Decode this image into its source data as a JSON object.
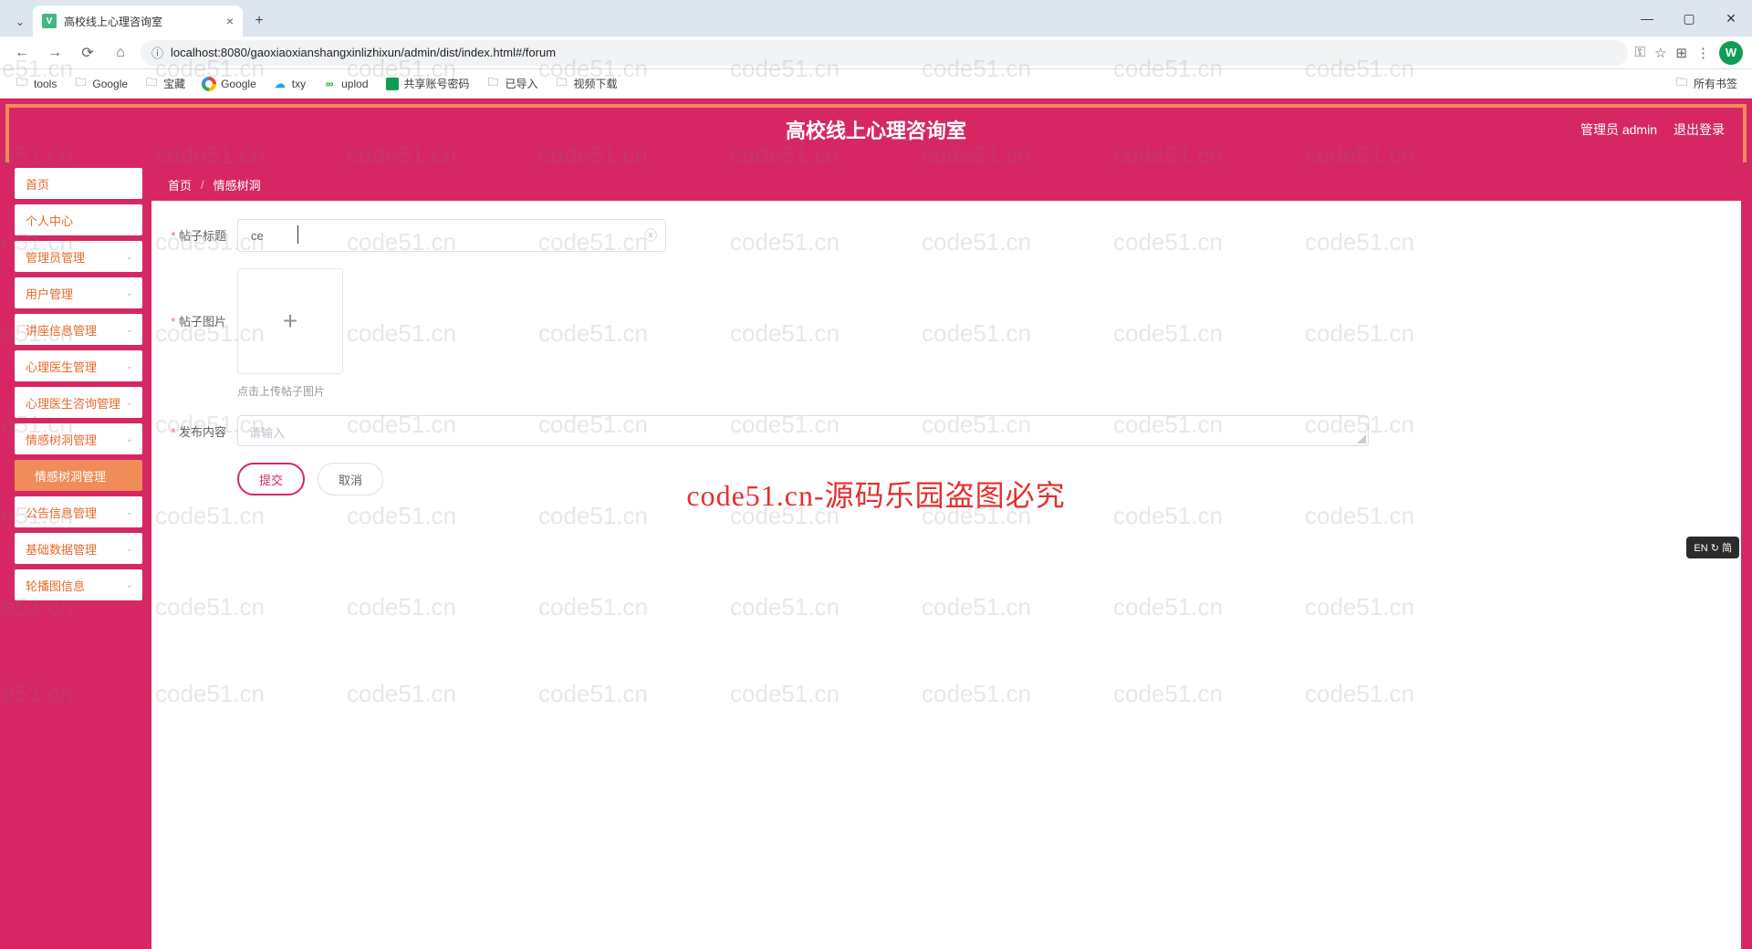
{
  "browser": {
    "tab_title": "高校线上心理咨询室",
    "url": "localhost:8080/gaoxiaoxianshangxinlizhixun/admin/dist/index.html#/forum",
    "profile_letter": "W",
    "window": {
      "min": "—",
      "max": "▢",
      "close": "✕"
    },
    "nav": {
      "back": "←",
      "forward": "→",
      "reload": "⟳",
      "home": "⌂",
      "lock": "ⓘ"
    },
    "addr_icons": {
      "key": "⚿",
      "star": "☆",
      "ext": "⊞",
      "menu": "⋮"
    }
  },
  "bookmarks": {
    "items": [
      {
        "icon": "folder",
        "label": "tools"
      },
      {
        "icon": "folder",
        "label": "Google"
      },
      {
        "icon": "folder",
        "label": "宝藏"
      },
      {
        "icon": "google",
        "label": "Google"
      },
      {
        "icon": "txy",
        "label": "txy"
      },
      {
        "icon": "uplod",
        "label": "uplod"
      },
      {
        "icon": "sheet",
        "label": "共享账号密码"
      },
      {
        "icon": "folder",
        "label": "已导入"
      },
      {
        "icon": "folder",
        "label": "视频下载"
      }
    ],
    "right": {
      "icon": "folder",
      "label": "所有书签"
    }
  },
  "header": {
    "title": "高校线上心理咨询室",
    "user": "管理员 admin",
    "logout": "退出登录"
  },
  "sidebar": {
    "items": [
      {
        "label": "首页",
        "expandable": false
      },
      {
        "label": "个人中心",
        "expandable": false
      },
      {
        "label": "管理员管理",
        "expandable": true
      },
      {
        "label": "用户管理",
        "expandable": true
      },
      {
        "label": "讲座信息管理",
        "expandable": true
      },
      {
        "label": "心理医生管理",
        "expandable": true
      },
      {
        "label": "心理医生咨询管理",
        "expandable": true
      },
      {
        "label": "情感树洞管理",
        "expandable": true
      },
      {
        "label": "情感树洞管理",
        "expandable": false,
        "active": true,
        "indent": true
      },
      {
        "label": "公告信息管理",
        "expandable": true
      },
      {
        "label": "基础数据管理",
        "expandable": true
      },
      {
        "label": "轮播图信息",
        "expandable": true
      }
    ],
    "caret": "⌄"
  },
  "breadcrumb": {
    "home": "首页",
    "sep": "/",
    "current": "情感树洞"
  },
  "form": {
    "title_label": "帖子标题",
    "title_value": "ce",
    "clear_icon": "ⓧ",
    "image_label": "帖子图片",
    "upload_plus": "+",
    "upload_hint": "点击上传帖子图片",
    "content_label": "发布内容",
    "content_placeholder": "请输入",
    "submit": "提交",
    "cancel": "取消"
  },
  "watermark": {
    "text": "code51.cn",
    "center": "code51.cn-源码乐园盗图必究"
  },
  "ime": "EN ↻ 简"
}
